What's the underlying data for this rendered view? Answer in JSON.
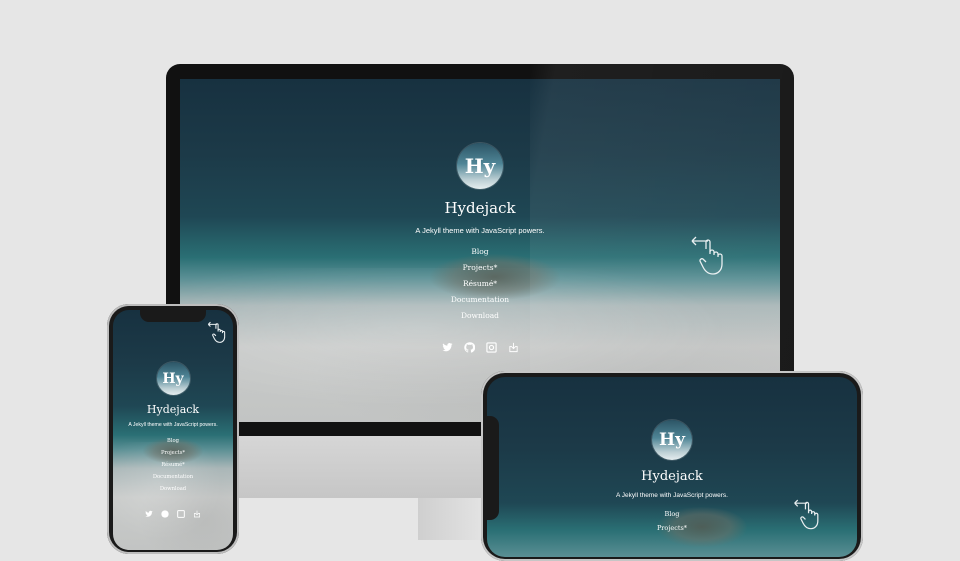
{
  "site": {
    "avatar_text": "Hy",
    "title": "Hydejack",
    "tagline": "A Jekyll theme with JavaScript powers."
  },
  "nav": [
    {
      "label": "Blog"
    },
    {
      "label": "Projects*"
    },
    {
      "label": "Résumé*"
    },
    {
      "label": "Documentation"
    },
    {
      "label": "Download"
    }
  ],
  "social_icons": [
    "twitter-icon",
    "github-icon",
    "email-icon",
    "download-icon"
  ],
  "gesture_icon": "swipe-left-hand-icon",
  "colors": {
    "background": "#e6e6e6",
    "bezel": "#111111",
    "screen_top": "#173140",
    "water": "#2a6f74",
    "sand": "#c9cbca"
  }
}
